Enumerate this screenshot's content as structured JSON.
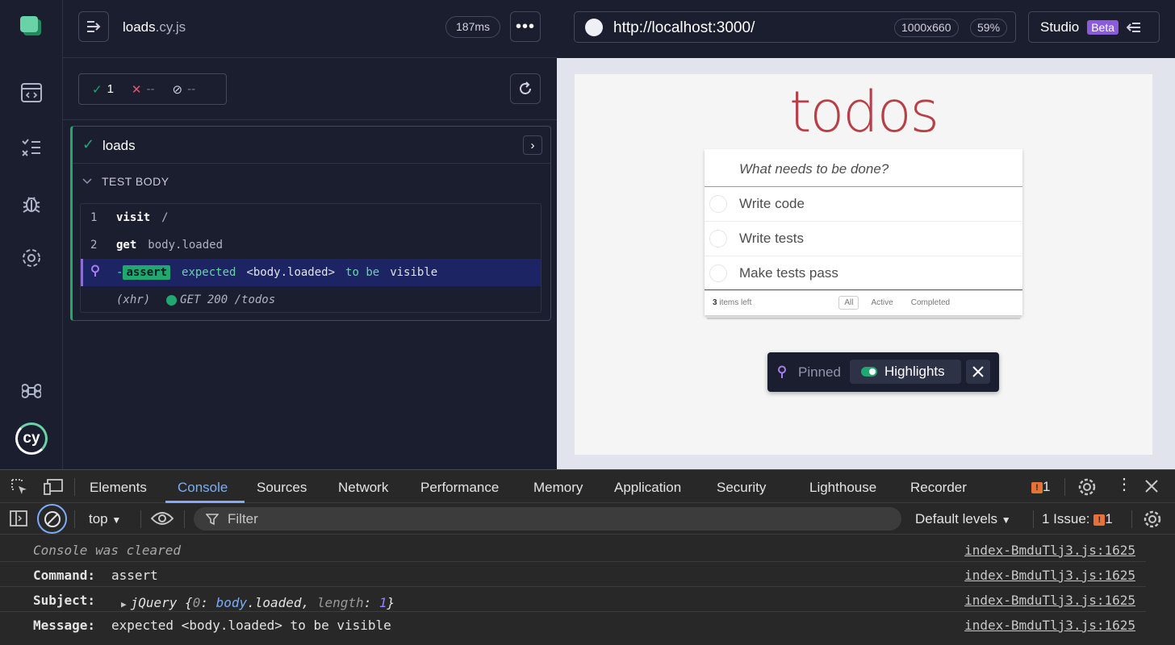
{
  "runner": {
    "spec_name": "loads",
    "spec_ext": ".cy.js",
    "duration": "187ms",
    "stats": {
      "passed": "1",
      "failed": "--",
      "pending": "--"
    },
    "test": {
      "title": "loads",
      "body_header": "TEST BODY",
      "commands": [
        {
          "num": "1",
          "name": "visit",
          "message": "/"
        },
        {
          "num": "2",
          "name": "get",
          "message": "body.loaded"
        }
      ],
      "assert": {
        "name": "assert",
        "w1": "expected",
        "sel": "<body.loaded>",
        "w2": "to be",
        "w3": "visible"
      },
      "xhr": {
        "label": "(xhr)",
        "text": "GET 200 /todos"
      }
    }
  },
  "browser": {
    "url": "http://localhost:3000/",
    "viewport": "1000x660",
    "zoom": "59%",
    "studio_label": "Studio",
    "beta_label": "Beta"
  },
  "aut": {
    "heading": "todos",
    "input_placeholder": "What needs to be done?",
    "items": [
      "Write code",
      "Write tests",
      "Make tests pass"
    ],
    "count": "3",
    "count_suffix": "items left",
    "filters": [
      "All",
      "Active",
      "Completed"
    ],
    "pinned_label": "Pinned",
    "highlights_label": "Highlights"
  },
  "devtools": {
    "tabs": [
      "Elements",
      "Console",
      "Sources",
      "Network",
      "Performance",
      "Memory",
      "Application",
      "Security",
      "Lighthouse",
      "Recorder"
    ],
    "active_tab": "Console",
    "warning_count": "1",
    "context": "top",
    "filter_placeholder": "Filter",
    "levels": "Default levels",
    "issues_label": "1 Issue:",
    "issues_count": "1",
    "logs": {
      "cleared": "Console was cleared",
      "command_label": "Command:",
      "command_value": "assert",
      "subject_label": "Subject:",
      "subject_prefix": "jQuery {",
      "subject_k0": "0",
      "subject_v0": "body",
      "subject_v0b": ".loaded",
      "subject_k1": "length",
      "subject_v1": "1",
      "message_label": "Message:",
      "message_value": "expected <body.loaded> to be visible",
      "source": "index-BmduTlj3.js:1625"
    }
  },
  "colors": {
    "accent_green": "#1fa971",
    "pin_purple": "#8f6dd9",
    "todos_red": "#b83f45",
    "devtools_blue": "#7cacf8"
  }
}
